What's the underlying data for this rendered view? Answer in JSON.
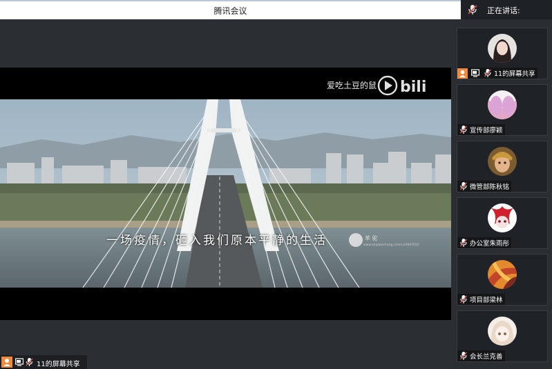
{
  "window": {
    "title": "腾讯会议"
  },
  "speaking": {
    "label": "正在讲话:"
  },
  "video": {
    "channel_text": "爱吃土豆的鼠",
    "logo_text": "bili",
    "subtitle": "一场疫情，砸入我们原本平静的生活",
    "watermark_name": "羊 驼",
    "watermark_url": "www.xinpianchang.com/u10007012"
  },
  "share": {
    "label": "11的屏幕共享"
  },
  "participants": [
    {
      "name": "11的屏幕共享",
      "sharing": true
    },
    {
      "name": "宣传部廖颖",
      "sharing": false
    },
    {
      "name": "微管部陈秋铭",
      "sharing": false
    },
    {
      "name": "办公室朱雨彤",
      "sharing": false
    },
    {
      "name": "项目部梁林",
      "sharing": false
    },
    {
      "name": "会长兰克善",
      "sharing": false
    }
  ],
  "colors": {
    "accent": "#f2893a",
    "panel": "#1f2226",
    "mic_off": "#d9534f"
  }
}
